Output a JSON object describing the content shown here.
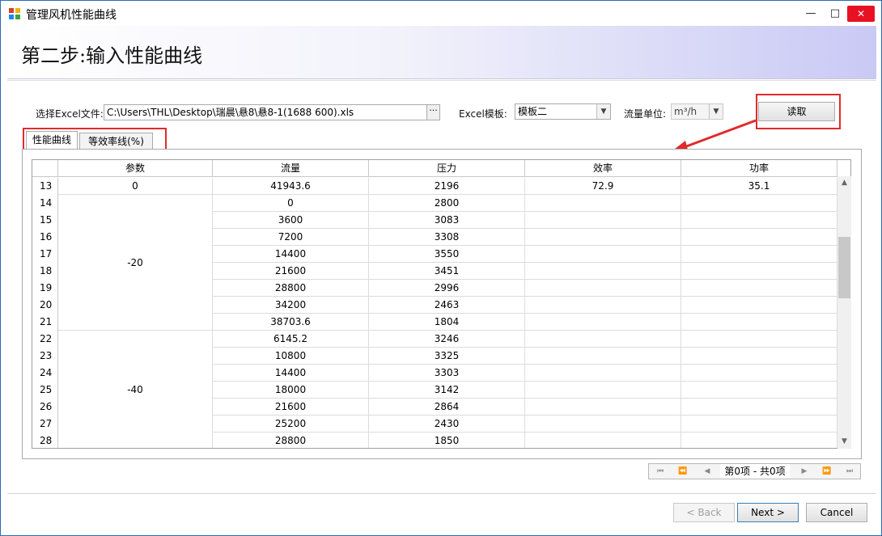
{
  "window": {
    "title": "管理风机性能曲线",
    "minimize": "—",
    "maximize": "□",
    "close": "✕"
  },
  "header": {
    "title": "第二步:输入性能曲线"
  },
  "form": {
    "excel_file_label": "选择Excel文件:",
    "excel_file_value": "C:\\Users\\THL\\Desktop\\瑞晨\\悬8\\悬8-1(1688 600).xls",
    "browse_label": "···",
    "template_label": "Excel模板:",
    "template_value": "模板二",
    "flow_unit_label": "流量单位:",
    "flow_unit_value": "m³/h",
    "read_button": "读取"
  },
  "tabs": [
    {
      "label": "性能曲线"
    },
    {
      "label": "等效率线(%)"
    }
  ],
  "grid": {
    "columns": [
      "参数",
      "流量",
      "压力",
      "效率",
      "功率"
    ],
    "rows": [
      {
        "num": "13",
        "flow": "41943.6",
        "pressure": "2196",
        "efficiency": "72.9",
        "power": "35.1"
      },
      {
        "num": "14",
        "flow": "0",
        "pressure": "2800",
        "efficiency": "",
        "power": ""
      },
      {
        "num": "15",
        "flow": "3600",
        "pressure": "3083",
        "efficiency": "",
        "power": ""
      },
      {
        "num": "16",
        "flow": "7200",
        "pressure": "3308",
        "efficiency": "",
        "power": ""
      },
      {
        "num": "17",
        "flow": "14400",
        "pressure": "3550",
        "efficiency": "",
        "power": ""
      },
      {
        "num": "18",
        "flow": "21600",
        "pressure": "3451",
        "efficiency": "",
        "power": ""
      },
      {
        "num": "19",
        "flow": "28800",
        "pressure": "2996",
        "efficiency": "",
        "power": ""
      },
      {
        "num": "20",
        "flow": "34200",
        "pressure": "2463",
        "efficiency": "",
        "power": ""
      },
      {
        "num": "21",
        "flow": "38703.6",
        "pressure": "1804",
        "efficiency": "",
        "power": ""
      },
      {
        "num": "22",
        "flow": "6145.2",
        "pressure": "3246",
        "efficiency": "",
        "power": ""
      },
      {
        "num": "23",
        "flow": "10800",
        "pressure": "3325",
        "efficiency": "",
        "power": ""
      },
      {
        "num": "24",
        "flow": "14400",
        "pressure": "3303",
        "efficiency": "",
        "power": ""
      },
      {
        "num": "25",
        "flow": "18000",
        "pressure": "3142",
        "efficiency": "",
        "power": ""
      },
      {
        "num": "26",
        "flow": "21600",
        "pressure": "2864",
        "efficiency": "",
        "power": ""
      },
      {
        "num": "27",
        "flow": "25200",
        "pressure": "2430",
        "efficiency": "",
        "power": ""
      },
      {
        "num": "28",
        "flow": "28800",
        "pressure": "1850",
        "efficiency": "",
        "power": ""
      }
    ],
    "param_groups": [
      {
        "value": "0",
        "rows": 1
      },
      {
        "value": "-20",
        "rows": 8
      },
      {
        "value": "-40",
        "rows": 7
      }
    ]
  },
  "pager": {
    "text": "第0项 - 共0项"
  },
  "buttons": {
    "back": "< Back",
    "next": "Next >",
    "cancel": "Cancel"
  },
  "colors": {
    "highlight": "#e02b2b",
    "header_gradient_end": "#c9c9f5",
    "title_border": "#2b6bb8"
  }
}
